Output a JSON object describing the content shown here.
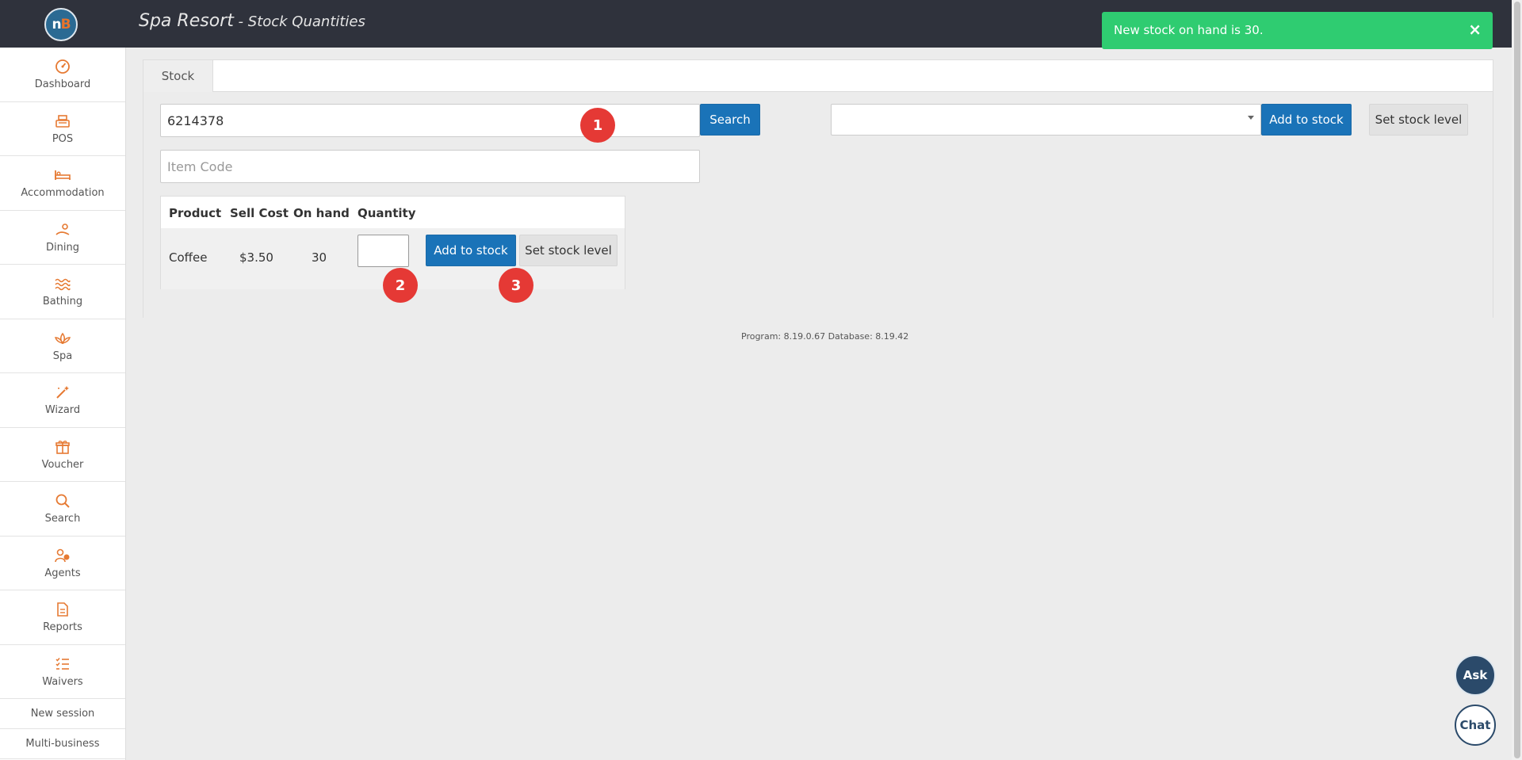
{
  "header": {
    "logo_text": "nB",
    "title": "Spa Resort",
    "subtitle": " - Stock Quantities"
  },
  "toast": {
    "message": "New stock on hand is 30.",
    "close": "×"
  },
  "sidebar": {
    "items": [
      {
        "label": "Dashboard",
        "icon": "gauge-icon"
      },
      {
        "label": "POS",
        "icon": "register-icon"
      },
      {
        "label": "Accommodation",
        "icon": "bed-icon"
      },
      {
        "label": "Dining",
        "icon": "dining-icon"
      },
      {
        "label": "Bathing",
        "icon": "waves-icon"
      },
      {
        "label": "Spa",
        "icon": "lotus-icon"
      },
      {
        "label": "Wizard",
        "icon": "magic-wand-icon"
      },
      {
        "label": "Voucher",
        "icon": "gift-icon"
      },
      {
        "label": "Search",
        "icon": "search-icon"
      },
      {
        "label": "Agents",
        "icon": "agents-icon"
      },
      {
        "label": "Reports",
        "icon": "report-icon"
      },
      {
        "label": "Waivers",
        "icon": "checklist-icon"
      }
    ],
    "links": [
      "New session",
      "Multi-business"
    ]
  },
  "tabs": [
    {
      "label": "Stock"
    }
  ],
  "search": {
    "value": "6214378",
    "button": "Search",
    "item_code_placeholder": "Item Code"
  },
  "right_controls": {
    "select_value": "",
    "add_button": "Add to stock",
    "set_button": "Set stock level"
  },
  "table": {
    "headers": [
      "Product",
      "Sell Cost",
      "On hand",
      "Quantity"
    ],
    "rows": [
      {
        "product": "Coffee",
        "sell_cost": "$3.50",
        "on_hand": "30",
        "quantity": ""
      }
    ],
    "add_button": "Add to stock",
    "set_button": "Set stock level"
  },
  "badges": [
    "1",
    "2",
    "3"
  ],
  "footer": {
    "version": "Program: 8.19.0.67 Database: 8.19.42"
  },
  "floating": {
    "ask": "Ask",
    "chat": "Chat"
  },
  "colors": {
    "topbar": "#2f323c",
    "accent": "#e67a33",
    "primary": "#1a73b8",
    "toast": "#2fcc71",
    "badge": "#e53935"
  }
}
